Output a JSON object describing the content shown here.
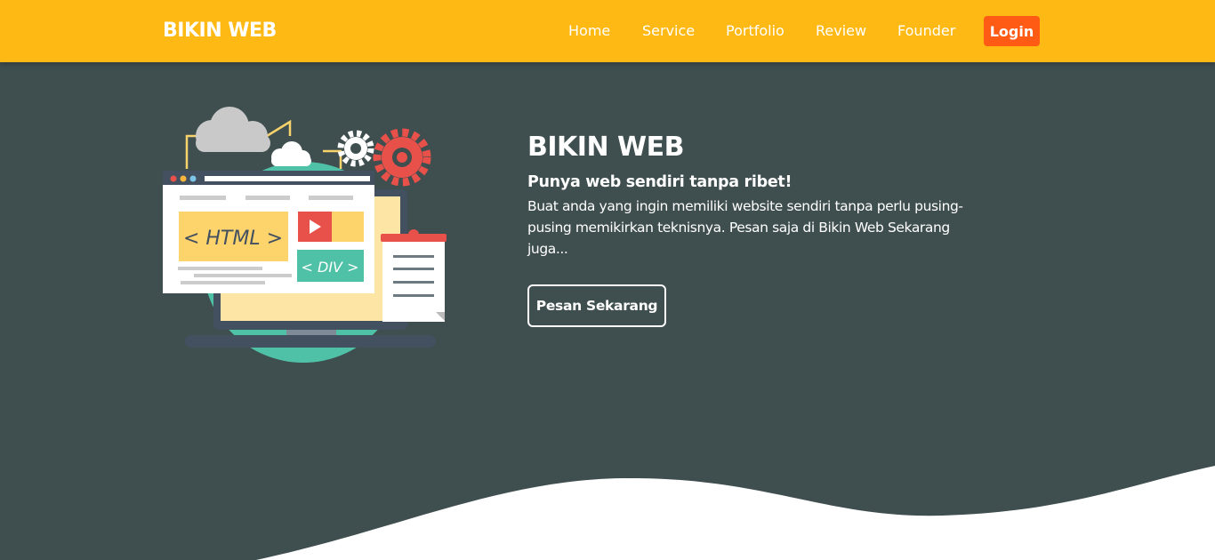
{
  "navbar": {
    "brand": "BIKIN WEB",
    "links": [
      "Home",
      "Service",
      "Portfolio",
      "Review",
      "Founder"
    ],
    "login_label": "Login"
  },
  "hero": {
    "title": "BIKIN WEB",
    "subtitle": "Punya web sendiri tanpa ribet!",
    "description": "Buat anda yang ingin memiliki website sendiri tanpa perlu pusing-pusing memikirkan teknisnya. Pesan saja di Bikin Web Sekarang juga...",
    "cta_label": "Pesan Sekarang",
    "illustration": {
      "html_tag": "< HTML >",
      "div_tag": "< DIV >"
    }
  },
  "colors": {
    "navbar_bg": "#ffb915",
    "login_bg": "#ff5b15",
    "hero_bg": "#3f4e4f",
    "accent_teal": "#4fc1a6"
  }
}
